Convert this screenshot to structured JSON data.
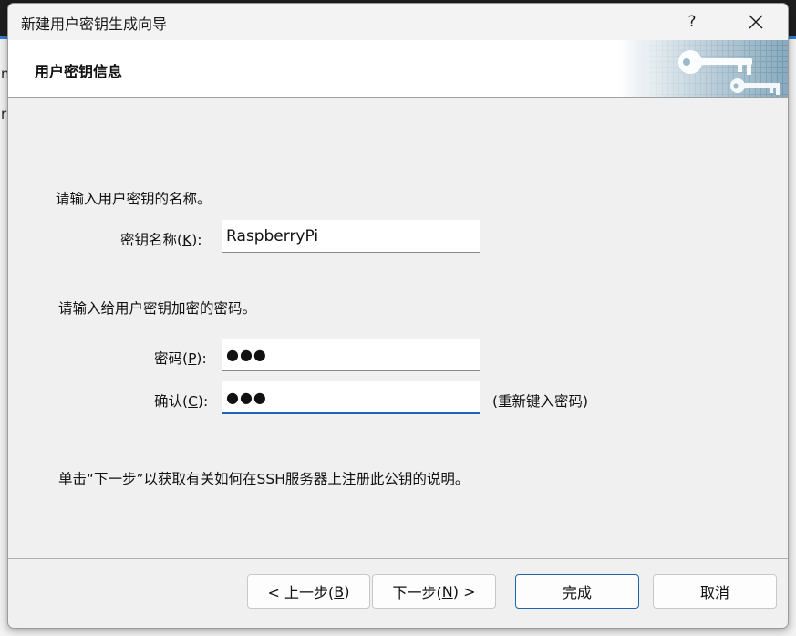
{
  "background": {
    "chars": [
      "n",
      "r"
    ]
  },
  "dialog": {
    "title": "新建用户密钥生成向导",
    "help_label": "?",
    "banner_title": "用户密钥信息"
  },
  "form": {
    "name_prompt": "请输入用户密钥的名称。",
    "key_name_label": "密钥名称(",
    "key_name_access": "K",
    "key_name_label_end": "):",
    "key_name_value": "RaspberryPi",
    "password_prompt": "请输入给用户密钥加密的密码。",
    "password_label": "密码(",
    "password_access": "P",
    "password_label_end": "):",
    "password_value": "●●●",
    "confirm_label": "确认(",
    "confirm_access": "C",
    "confirm_label_end": "):",
    "confirm_value": "●●●",
    "confirm_hint": "(重新键入密码)",
    "info_text": "单击“下一步”以获取有关如何在SSH服务器上注册此公钥的说明。"
  },
  "buttons": {
    "back_label": "< 上一步(",
    "back_access": "B",
    "back_end": ")",
    "next_label": "下一步(",
    "next_access": "N",
    "next_end": ") >",
    "finish_label": "完成",
    "cancel_label": "取消"
  },
  "colors": {
    "accent": "#1f63b0",
    "dialog_bg": "#f0f0f0"
  }
}
